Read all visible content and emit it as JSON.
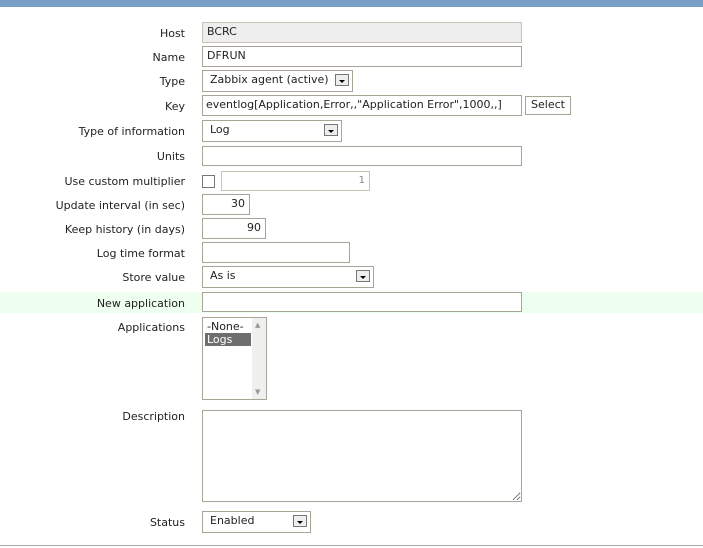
{
  "fields": {
    "host": {
      "label": "Host",
      "value": "BCRC"
    },
    "name": {
      "label": "Name",
      "value": "DFRUN"
    },
    "type": {
      "label": "Type",
      "value": "Zabbix agent (active)"
    },
    "key": {
      "label": "Key",
      "value": "eventlog[Application,Error,,\"Application Error\",1000,,]",
      "button": "Select"
    },
    "type_info": {
      "label": "Type of information",
      "value": "Log"
    },
    "units": {
      "label": "Units",
      "value": ""
    },
    "multiplier": {
      "label": "Use custom multiplier",
      "value": "1"
    },
    "update": {
      "label": "Update interval (in sec)",
      "value": "30"
    },
    "history": {
      "label": "Keep history (in days)",
      "value": "90"
    },
    "logtime": {
      "label": "Log time format",
      "value": ""
    },
    "store": {
      "label": "Store value",
      "value": "As is"
    },
    "newapp": {
      "label": "New application",
      "value": ""
    },
    "apps": {
      "label": "Applications",
      "options": [
        "-None-",
        "Logs"
      ]
    },
    "description": {
      "label": "Description",
      "value": ""
    },
    "status": {
      "label": "Status",
      "value": "Enabled"
    }
  }
}
